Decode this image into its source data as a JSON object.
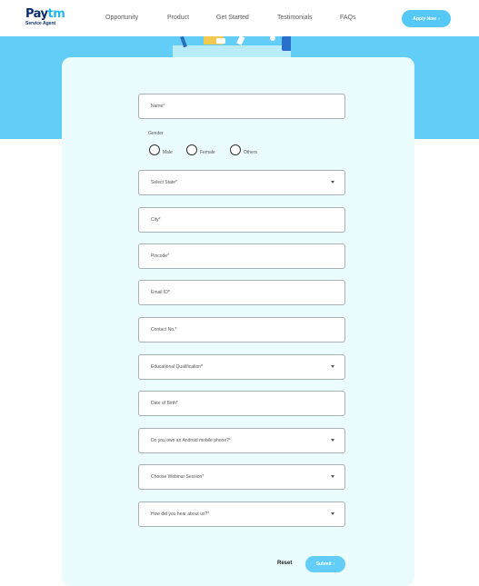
{
  "header": {
    "logo_pay": "Pay",
    "logo_tm": "tm",
    "logo_sub": "Service Agent",
    "nav": [
      "Opportunity",
      "Product",
      "Get Started",
      "Testimonials",
      "FAQs"
    ],
    "apply_label": "Apply Now",
    "apply_arrow": "›"
  },
  "form": {
    "name_placeholder": "Name*",
    "gender_label": "Gender",
    "gender_options": [
      "Male",
      "Female",
      "Others"
    ],
    "state_placeholder": "Select State*",
    "city_placeholder": "City*",
    "pincode_placeholder": "Pincode*",
    "email_placeholder": "Email ID*",
    "contact_placeholder": "Contact No.*",
    "qualification_placeholder": "Educational Qualification*",
    "dob_placeholder": "Date of Birth*",
    "android_placeholder": "Do you own an Android mobile phone?*",
    "webinar_placeholder": "Choose Webinar Session*",
    "hear_placeholder": "How did you hear about us?*",
    "reset_label": "Reset",
    "submit_label": "Submit",
    "submit_arrow": "›"
  },
  "colors": {
    "band": "#62cdf7",
    "card": "#eafcfd",
    "brand_dark": "#0b2b6e",
    "brand_light": "#1fb6f0"
  }
}
